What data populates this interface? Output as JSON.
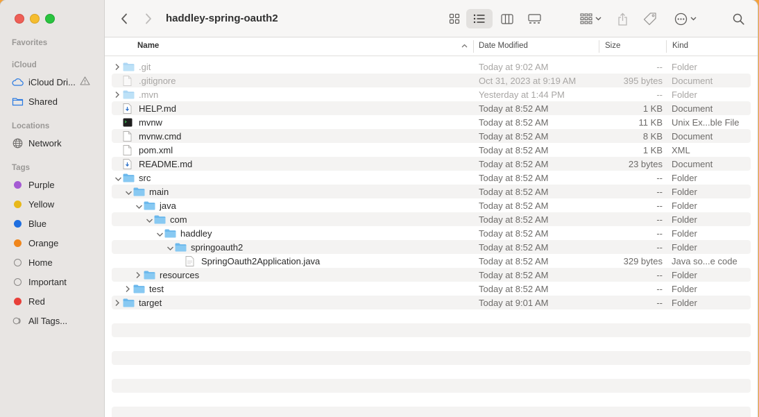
{
  "window": {
    "title": "haddley-spring-oauth2"
  },
  "sidebar": {
    "favorites_label": "Favorites",
    "icloud_label": "iCloud",
    "icloud_items": [
      {
        "label": "iCloud Dri...",
        "icon": "cloud-icon"
      },
      {
        "label": "Shared",
        "icon": "shared-folder-icon"
      }
    ],
    "locations_label": "Locations",
    "locations_items": [
      {
        "label": "Network",
        "icon": "network-icon"
      }
    ],
    "tags_label": "Tags",
    "tags": [
      {
        "label": "Purple",
        "color": "#a55bd3"
      },
      {
        "label": "Yellow",
        "color": "#e8b81a"
      },
      {
        "label": "Blue",
        "color": "#1f6fe0"
      },
      {
        "label": "Orange",
        "color": "#f0861c"
      },
      {
        "label": "Home",
        "color": ""
      },
      {
        "label": "Important",
        "color": ""
      },
      {
        "label": "Red",
        "color": "#e8403a"
      },
      {
        "label": "All Tags...",
        "color": ""
      }
    ]
  },
  "columns": {
    "name": "Name",
    "date": "Date Modified",
    "size": "Size",
    "kind": "Kind"
  },
  "files": [
    {
      "name": ".git",
      "date": "Today at 9:02 AM",
      "size": "--",
      "kind": "Folder",
      "icon": "folder-icon",
      "indent": 0,
      "disclosure": "collapsed",
      "dim": true
    },
    {
      "name": ".gitignore",
      "date": "Oct 31, 2023 at 9:19 AM",
      "size": "395 bytes",
      "kind": "Document",
      "icon": "document-icon",
      "indent": 0,
      "disclosure": "",
      "dim": true
    },
    {
      "name": ".mvn",
      "date": "Yesterday at 1:44 PM",
      "size": "--",
      "kind": "Folder",
      "icon": "folder-icon",
      "indent": 0,
      "disclosure": "collapsed",
      "dim": true
    },
    {
      "name": "HELP.md",
      "date": "Today at 8:52 AM",
      "size": "1 KB",
      "kind": "Document",
      "icon": "markdown-file-icon",
      "indent": 0,
      "disclosure": "",
      "dim": false
    },
    {
      "name": "mvnw",
      "date": "Today at 8:52 AM",
      "size": "11 KB",
      "kind": "Unix Ex...ble File",
      "icon": "terminal-exec-icon",
      "indent": 0,
      "disclosure": "",
      "dim": false
    },
    {
      "name": "mvnw.cmd",
      "date": "Today at 8:52 AM",
      "size": "8 KB",
      "kind": "Document",
      "icon": "document-icon",
      "indent": 0,
      "disclosure": "",
      "dim": false
    },
    {
      "name": "pom.xml",
      "date": "Today at 8:52 AM",
      "size": "1 KB",
      "kind": "XML",
      "icon": "document-icon",
      "indent": 0,
      "disclosure": "",
      "dim": false
    },
    {
      "name": "README.md",
      "date": "Today at 8:52 AM",
      "size": "23 bytes",
      "kind": "Document",
      "icon": "markdown-file-icon",
      "indent": 0,
      "disclosure": "",
      "dim": false
    },
    {
      "name": "src",
      "date": "Today at 8:52 AM",
      "size": "--",
      "kind": "Folder",
      "icon": "folder-icon",
      "indent": 0,
      "disclosure": "expanded",
      "dim": false
    },
    {
      "name": "main",
      "date": "Today at 8:52 AM",
      "size": "--",
      "kind": "Folder",
      "icon": "folder-icon",
      "indent": 1,
      "disclosure": "expanded",
      "dim": false
    },
    {
      "name": "java",
      "date": "Today at 8:52 AM",
      "size": "--",
      "kind": "Folder",
      "icon": "folder-icon",
      "indent": 2,
      "disclosure": "expanded",
      "dim": false
    },
    {
      "name": "com",
      "date": "Today at 8:52 AM",
      "size": "--",
      "kind": "Folder",
      "icon": "folder-icon",
      "indent": 3,
      "disclosure": "expanded",
      "dim": false
    },
    {
      "name": "haddley",
      "date": "Today at 8:52 AM",
      "size": "--",
      "kind": "Folder",
      "icon": "folder-icon",
      "indent": 4,
      "disclosure": "expanded",
      "dim": false
    },
    {
      "name": "springoauth2",
      "date": "Today at 8:52 AM",
      "size": "--",
      "kind": "Folder",
      "icon": "folder-icon",
      "indent": 5,
      "disclosure": "expanded",
      "dim": false
    },
    {
      "name": "SpringOauth2Application.java",
      "date": "Today at 8:52 AM",
      "size": "329 bytes",
      "kind": "Java so...e code",
      "icon": "java-file-icon",
      "indent": 6,
      "disclosure": "",
      "dim": false
    },
    {
      "name": "resources",
      "date": "Today at 8:52 AM",
      "size": "--",
      "kind": "Folder",
      "icon": "folder-icon",
      "indent": 2,
      "disclosure": "collapsed",
      "dim": false
    },
    {
      "name": "test",
      "date": "Today at 8:52 AM",
      "size": "--",
      "kind": "Folder",
      "icon": "folder-icon",
      "indent": 1,
      "disclosure": "collapsed",
      "dim": false
    },
    {
      "name": "target",
      "date": "Today at 9:01 AM",
      "size": "--",
      "kind": "Folder",
      "icon": "folder-icon",
      "indent": 0,
      "disclosure": "collapsed",
      "dim": false
    }
  ]
}
